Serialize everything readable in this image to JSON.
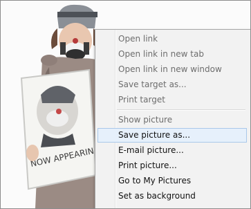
{
  "context_menu": {
    "items": [
      {
        "label": "Open link",
        "enabled": false
      },
      {
        "label": "Open link in new tab",
        "enabled": false
      },
      {
        "label": "Open link in new window",
        "enabled": false
      },
      {
        "label": "Save target as...",
        "enabled": false
      },
      {
        "label": "Print target",
        "enabled": false
      },
      {
        "label": "Show picture",
        "enabled": false
      },
      {
        "label": "Save picture as...",
        "enabled": true,
        "highlighted": true
      },
      {
        "label": "E-mail picture...",
        "enabled": true
      },
      {
        "label": "Print picture...",
        "enabled": true
      },
      {
        "label": "Go to My Pictures",
        "enabled": true
      },
      {
        "label": "Set as background",
        "enabled": true
      }
    ]
  },
  "photo": {
    "sign_text": "NOW APPEARIN"
  },
  "colors": {
    "hover_background": "#e6f0fb",
    "hover_border": "#a9c8ea",
    "disabled_text": "#6d6d6d",
    "menu_background": "#f2f2f2"
  }
}
